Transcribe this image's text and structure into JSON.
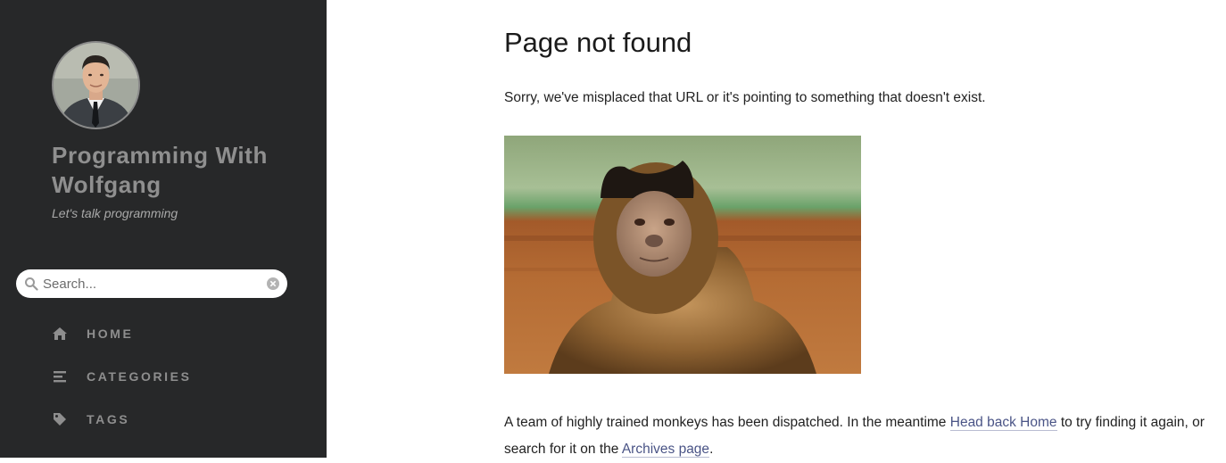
{
  "sidebar": {
    "site_title": "Programming With Wolfgang",
    "site_subtitle": "Let's talk programming",
    "search": {
      "placeholder": "Search...",
      "value": ""
    },
    "nav": [
      {
        "label": "HOME",
        "icon": "home-icon"
      },
      {
        "label": "CATEGORIES",
        "icon": "list-icon"
      },
      {
        "label": "TAGS",
        "icon": "tag-icon"
      }
    ]
  },
  "main": {
    "title": "Page not found",
    "lead": "Sorry, we've misplaced that URL or it's pointing to something that doesn't exist.",
    "body": {
      "before_home": "A team of highly trained monkeys has been dispatched. In the meantime ",
      "home_link": "Head back Home",
      "between": " to try finding it again, or search for it on the ",
      "archives_link": "Archives page",
      "after": "."
    }
  },
  "colors": {
    "sidebar_bg": "#272829",
    "link": "#4a5486",
    "title_text": "#8f8f8f"
  }
}
